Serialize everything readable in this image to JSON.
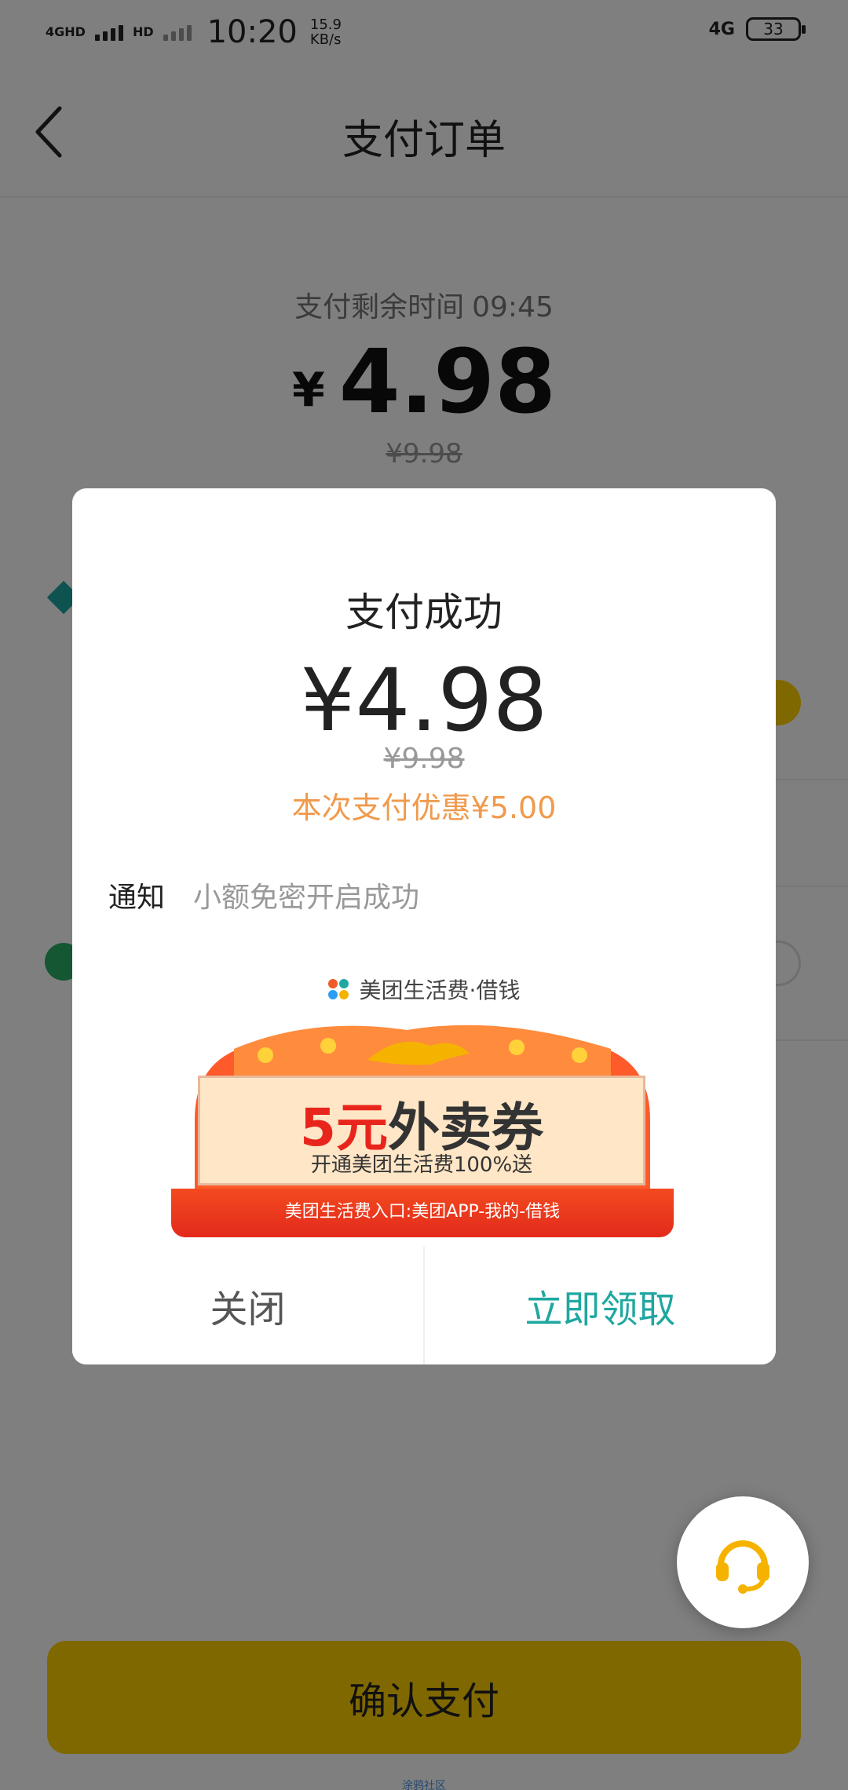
{
  "status_bar": {
    "network": "4GHD",
    "network2": "HD",
    "time": "10:20",
    "speed_value": "15.9",
    "speed_unit": "KB/s",
    "right_network": "4G",
    "battery": "33"
  },
  "header": {
    "title": "支付订单",
    "back_icon": "chevron-left-icon"
  },
  "order": {
    "countdown_label": "支付剩余时间",
    "countdown_time": "09:45",
    "currency": "¥",
    "amount": "4.98",
    "original_price": "¥9.98"
  },
  "dialog": {
    "title": "支付成功",
    "amount": "¥4.98",
    "original_price": "¥9.98",
    "discount_text": "本次支付优惠¥5.00",
    "notice_label": "通知",
    "notice_text": "小额免密开启成功",
    "banner": {
      "brand": "美团生活费·借钱",
      "coupon_value": "5元",
      "coupon_name": "外卖券",
      "subtitle": "开通美团生活费100%送",
      "entry_text": "美团生活费入口:美团APP-我的-借钱"
    },
    "close_label": "关闭",
    "claim_label": "立即领取"
  },
  "confirm_button": "确认支付",
  "footer_mark": "涂鸦社区",
  "colors": {
    "accent_yellow": "#ffd100",
    "discount_orange": "#f09a4c",
    "claim_teal": "#1fa7a0",
    "service_orange": "#f5b300"
  },
  "icons": {
    "customer_service": "headset-icon"
  }
}
